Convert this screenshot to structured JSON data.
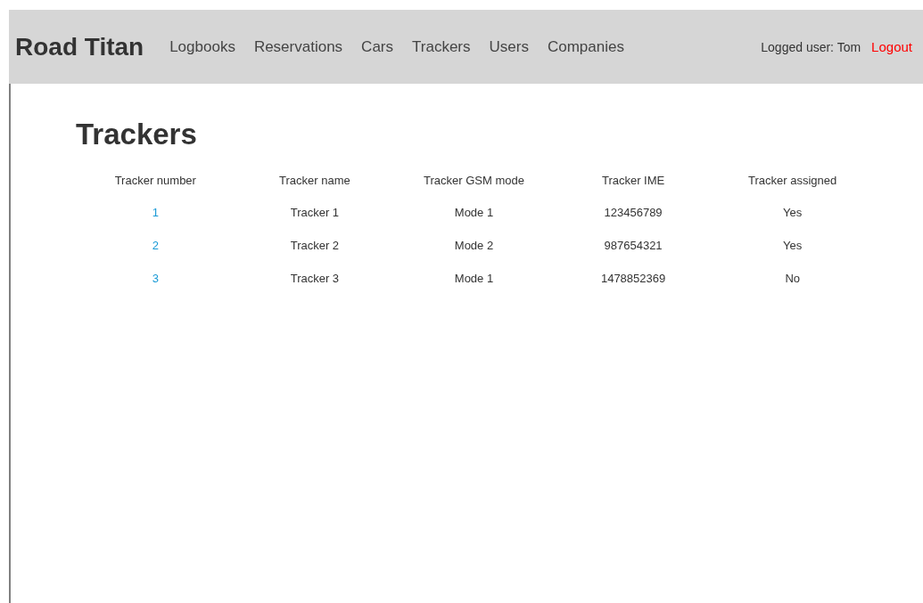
{
  "brand": "Road Titan",
  "nav": [
    "Logbooks",
    "Reservations",
    "Cars",
    "Trackers",
    "Users",
    "Companies"
  ],
  "user": {
    "label": "Logged user: Tom",
    "logout": "Logout"
  },
  "heading": "Trackers",
  "table": {
    "columns": [
      "Tracker number",
      "Tracker name",
      "Tracker GSM mode",
      "Tracker IME",
      "Tracker assigned"
    ],
    "rows": [
      {
        "number": "1",
        "name": "Tracker 1",
        "mode": "Mode 1",
        "ime": "123456789",
        "assigned": "Yes"
      },
      {
        "number": "2",
        "name": "Tracker 2",
        "mode": "Mode 2",
        "ime": "987654321",
        "assigned": "Yes"
      },
      {
        "number": "3",
        "name": "Tracker 3",
        "mode": "Mode 1",
        "ime": "1478852369",
        "assigned": "No"
      }
    ]
  }
}
